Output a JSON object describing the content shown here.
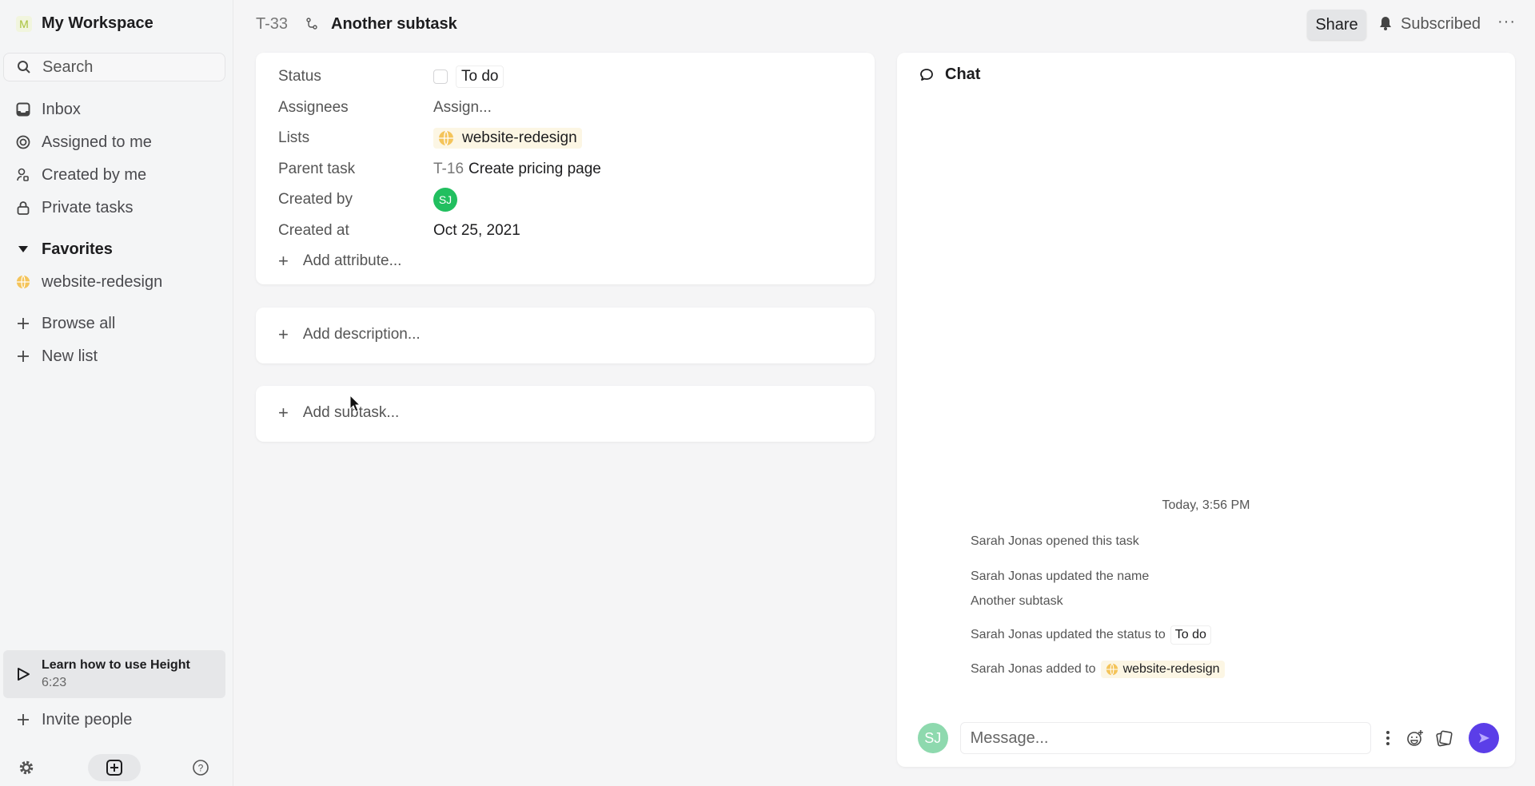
{
  "workspace": {
    "initial": "M",
    "name": "My Workspace"
  },
  "sidebar": {
    "search_placeholder": "Search",
    "nav": [
      {
        "label": "Inbox",
        "icon": "inbox-icon"
      },
      {
        "label": "Assigned to me",
        "icon": "target-icon"
      },
      {
        "label": "Created by me",
        "icon": "user-created-icon"
      },
      {
        "label": "Private tasks",
        "icon": "lock-icon"
      }
    ],
    "favorites_label": "Favorites",
    "favorites": [
      {
        "label": "website-redesign",
        "icon": "globe-icon"
      }
    ],
    "actions": [
      {
        "label": "Browse all"
      },
      {
        "label": "New list"
      }
    ],
    "learn": {
      "title": "Learn how to use Height",
      "duration": "6:23"
    },
    "invite_label": "Invite people"
  },
  "header": {
    "task_id": "T-33",
    "title": "Another subtask",
    "share_label": "Share",
    "subscribed_label": "Subscribed",
    "more_label": "···"
  },
  "details": {
    "rows": [
      {
        "label": "Status",
        "value": "To do"
      },
      {
        "label": "Assignees",
        "value": "Assign..."
      },
      {
        "label": "Lists",
        "value": "website-redesign"
      },
      {
        "label": "Parent task",
        "id": "T-16",
        "value": "Create pricing page"
      },
      {
        "label": "Created by",
        "value": "SJ"
      },
      {
        "label": "Created at",
        "value": "Oct 25, 2021"
      }
    ],
    "add_attribute": "Add attribute...",
    "add_description": "Add description...",
    "add_subtask": "Add subtask..."
  },
  "chat": {
    "title": "Chat",
    "timestamp": "Today, 3:56 PM",
    "events": [
      {
        "text": "Sarah Jonas opened this task"
      },
      {
        "text": "Sarah Jonas updated the name",
        "detail": "Another subtask"
      },
      {
        "text": "Sarah Jonas updated the status to",
        "chip": "To do"
      },
      {
        "text": "Sarah Jonas added to",
        "list": "website-redesign"
      }
    ],
    "avatar": "SJ",
    "message_placeholder": "Message..."
  },
  "colors": {
    "accent": "#5b3ee8",
    "avatar_green": "#21bf5f",
    "list_chip_bg": "#fcf6e4"
  }
}
